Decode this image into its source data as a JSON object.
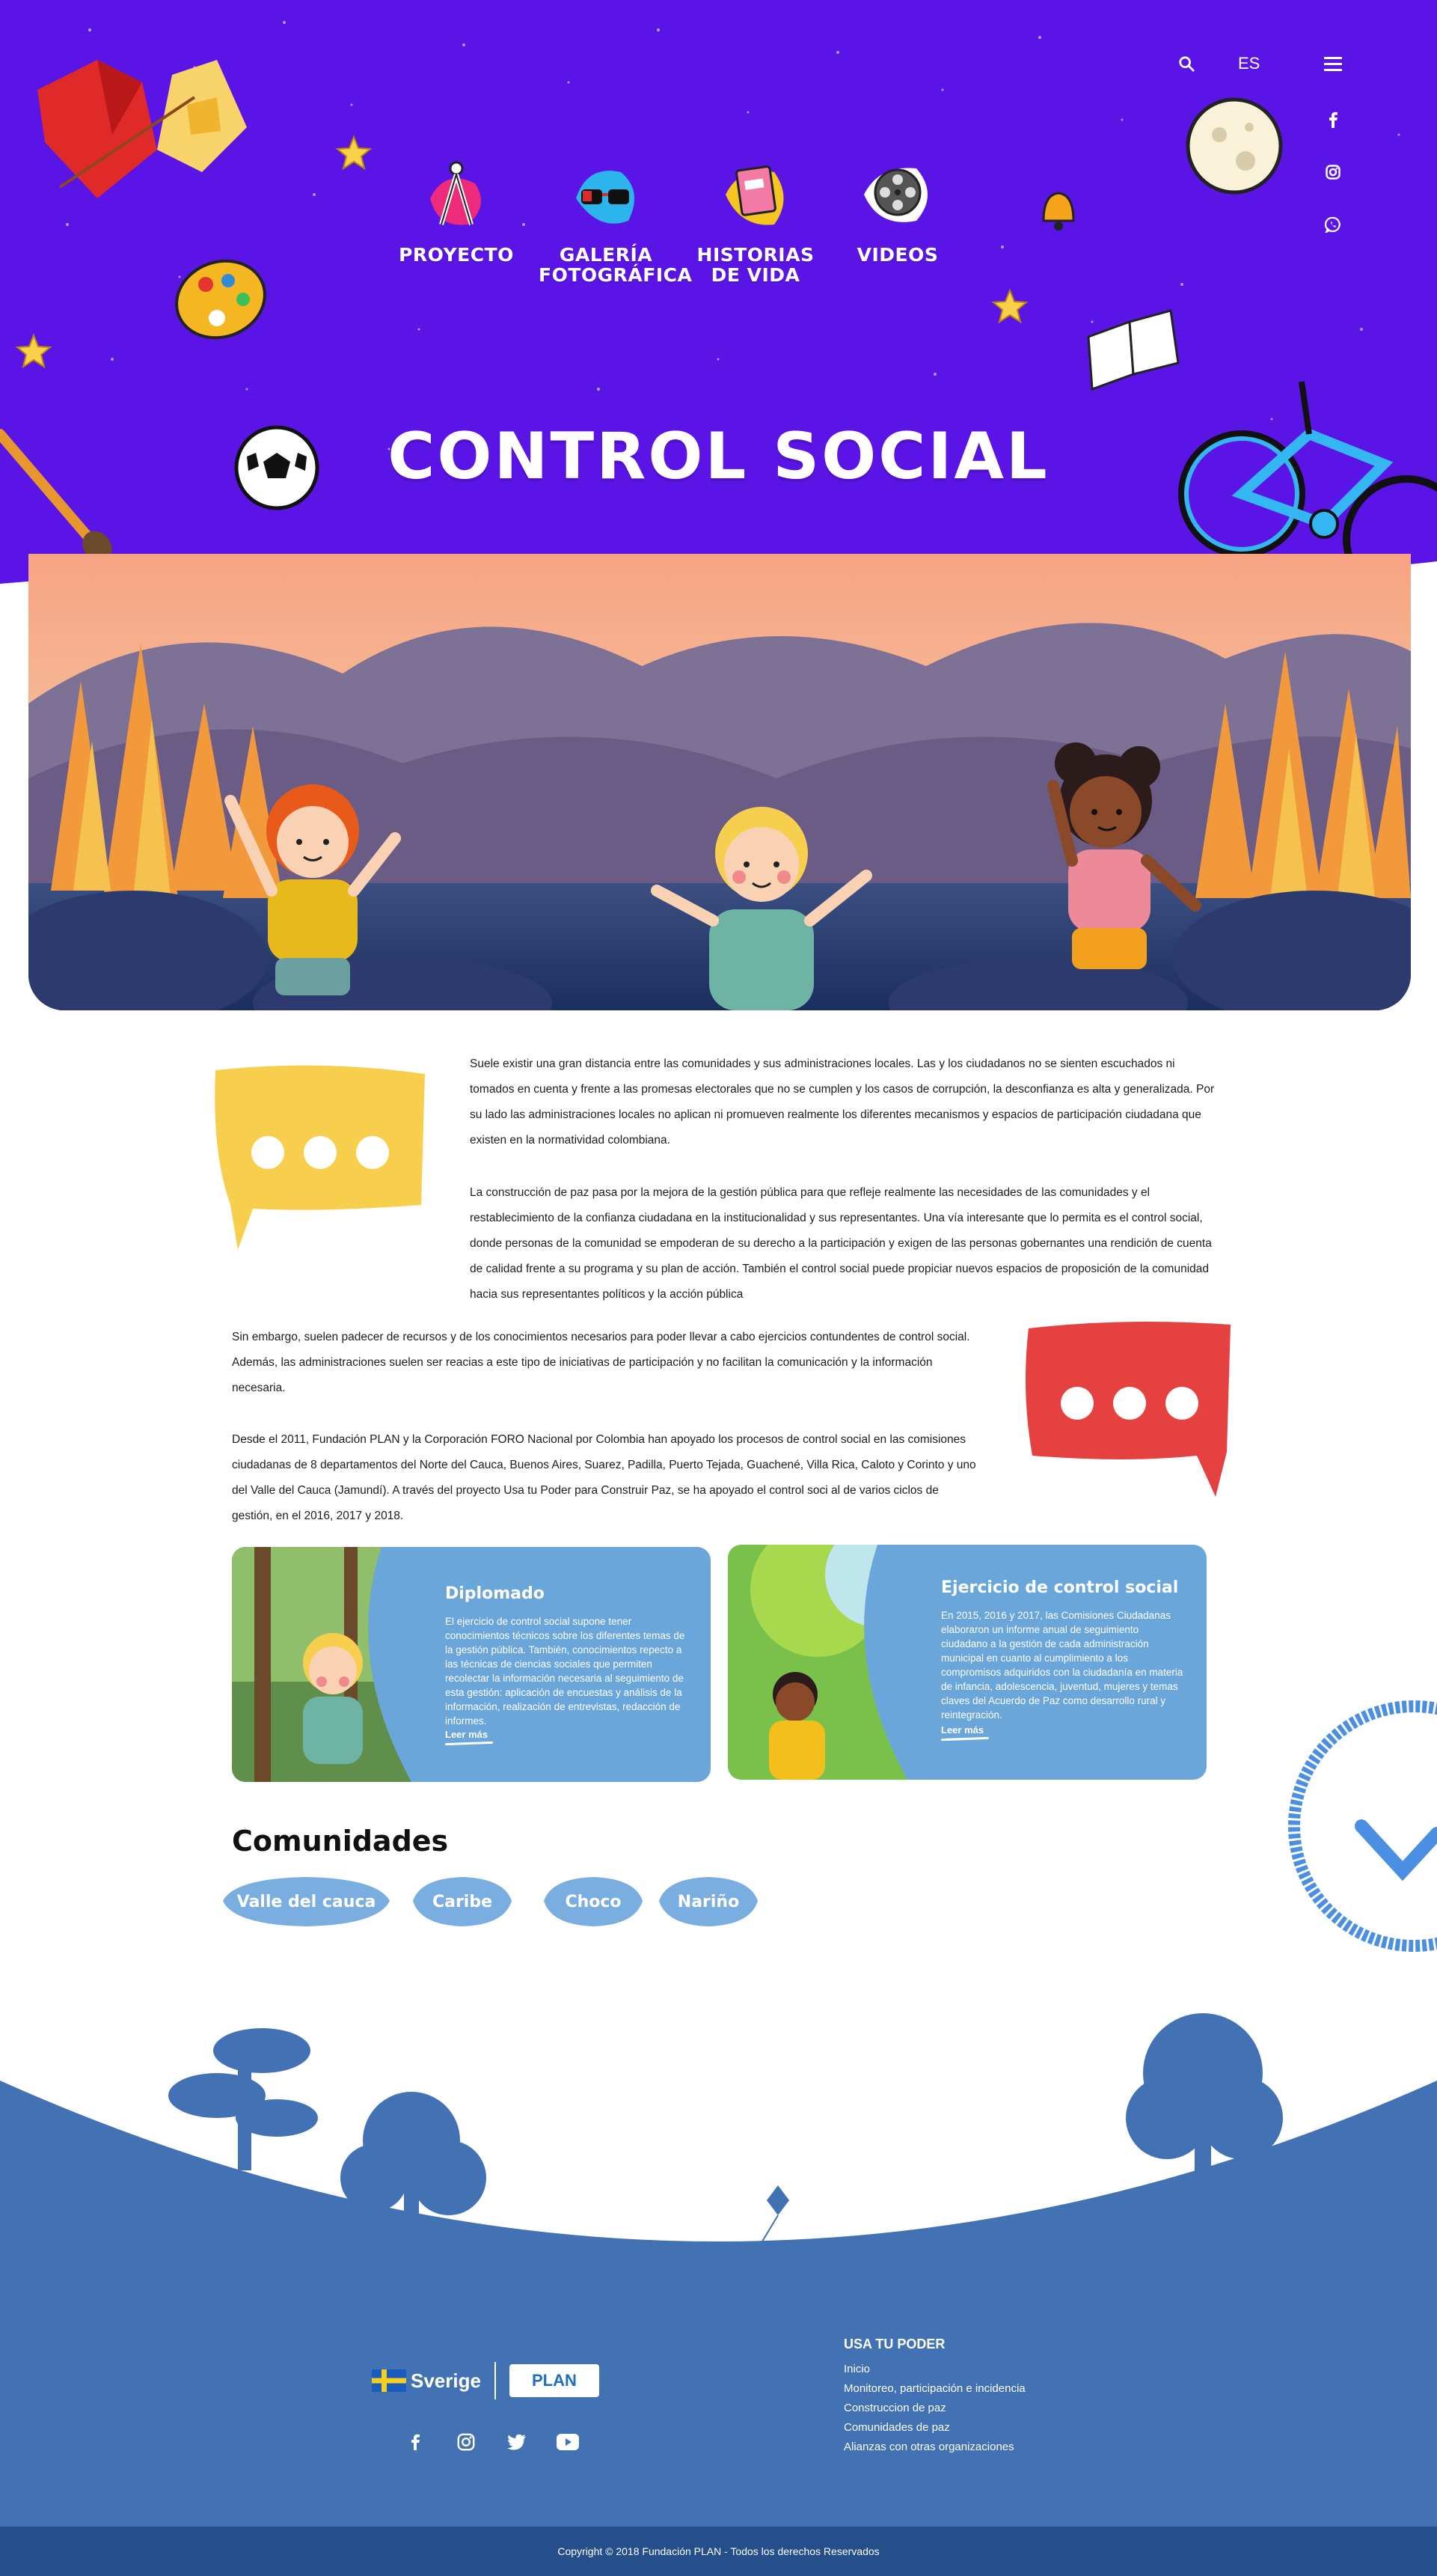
{
  "header": {
    "language": "ES",
    "title": "CONTROL SOCIAL",
    "nav": [
      {
        "label_line1": "PROYECTO",
        "label_line2": ""
      },
      {
        "label_line1": "GALERÍA",
        "label_line2": "FOTOGRÁFICA"
      },
      {
        "label_line1": "HISTORIAS",
        "label_line2": "DE VIDA"
      },
      {
        "label_line1": "VIDEOS",
        "label_line2": ""
      }
    ]
  },
  "intro": {
    "p1": "Suele existir una gran distancia entre las comunidades y sus administraciones locales. Las y los ciudadanos no se sienten escuchados ni tomados en cuenta y frente a las promesas electorales que no se cumplen y los casos de corrupción, la desconfianza es alta y generalizada. Por su lado las administraciones locales no aplican ni promueven realmente los diferentes mecanismos y espacios de participación ciudadana que existen en la normatividad colombiana.",
    "p2": "La construcción de paz pasa por la mejora de la gestión pública para que refleje realmente las necesidades de las comunidades y el restablecimiento de la confianza ciudadana en la institucionalidad y sus representantes. Una vía interesante que lo permita es el control social, donde personas de la comunidad se empoderan de su derecho a la participación y exigen de las personas gobernantes una rendición de cuenta de calidad frente a su programa y su plan de acción. También el control social puede propiciar nuevos espacios de proposición de la comunidad hacia sus representantes políticos y la acción pública",
    "p3": "Sin embargo, suelen padecer de recursos y de los conocimientos necesarios para poder llevar a cabo ejercicios contundentes de control social. Además, las administraciones suelen ser reacias a este tipo de iniciativas de participación y no facilitan la comunicación y la información necesaria.",
    "p4": "Desde el 2011, Fundación PLAN y la Corporación FORO Nacional por Colombia han apoyado los procesos de control social en las comisiones ciudadanas de 8 departamentos del Norte del Cauca, Buenos Aires, Suarez, Padilla, Puerto Tejada, Guachené, Villa Rica, Caloto y Corinto y uno del Valle del Cauca (Jamundí). A través del proyecto Usa tu Poder para Construir Paz, se ha apoyado el control soci al de varios ciclos de gestión, en el 2016, 2017 y 2018."
  },
  "cards": [
    {
      "title": "Diplomado",
      "body": "El ejercicio de control social supone tener conocimientos técnicos sobre los diferentes temas de la gestión pública. También, conocimientos repecto a las técnicas de ciencias sociales que permiten recolectar la información necesaria al seguimiento de esta gestión: aplicación de encuestas y análisis de la información, realización de entrevistas, redacción de informes.",
      "more": "Leer más"
    },
    {
      "title": "Ejercicio de control social",
      "body": "En 2015, 2016 y 2017, las Comisiones Ciudadanas elaboraron un informe anual de seguimiento ciudadano a la gestión de cada administración municipal en cuanto al cumplimiento a los compromisos adquiridos con la ciudadanía en materia de infancia, adolescencia, juventud, mujeres y temas claves del Acuerdo de Paz como desarrollo rural y reintegración.",
      "more": "Leer más"
    }
  ],
  "communities": {
    "title": "Comunidades",
    "items": [
      "Valle del cauca",
      "Caribe",
      "Choco",
      "Nariño"
    ]
  },
  "footer": {
    "sverige": "Sverige",
    "plan": "PLAN",
    "links_title": "USA TU PODER",
    "links": [
      "Inicio",
      "Monitoreo, participación e incidencia",
      "Construccion de paz",
      "Comunidades de paz",
      "Alianzas con otras organizaciones"
    ],
    "copyright": "Copyright © 2018 Fundación PLAN - Todos los derechos Reservados"
  },
  "colors": {
    "hero_purple": "#5a14e6",
    "card_blue": "#6aa6da",
    "footer_blue": "#4272b4",
    "copyright_blue": "#244f8a",
    "bubble_yellow": "#f8cf4c",
    "bubble_red": "#e64141"
  },
  "icons": [
    "search-icon",
    "menu-icon",
    "facebook-icon",
    "instagram-icon",
    "whatsapp-icon",
    "twitter-icon",
    "youtube-icon",
    "compass-icon",
    "glasses-icon",
    "book-icon",
    "film-reel-icon"
  ]
}
